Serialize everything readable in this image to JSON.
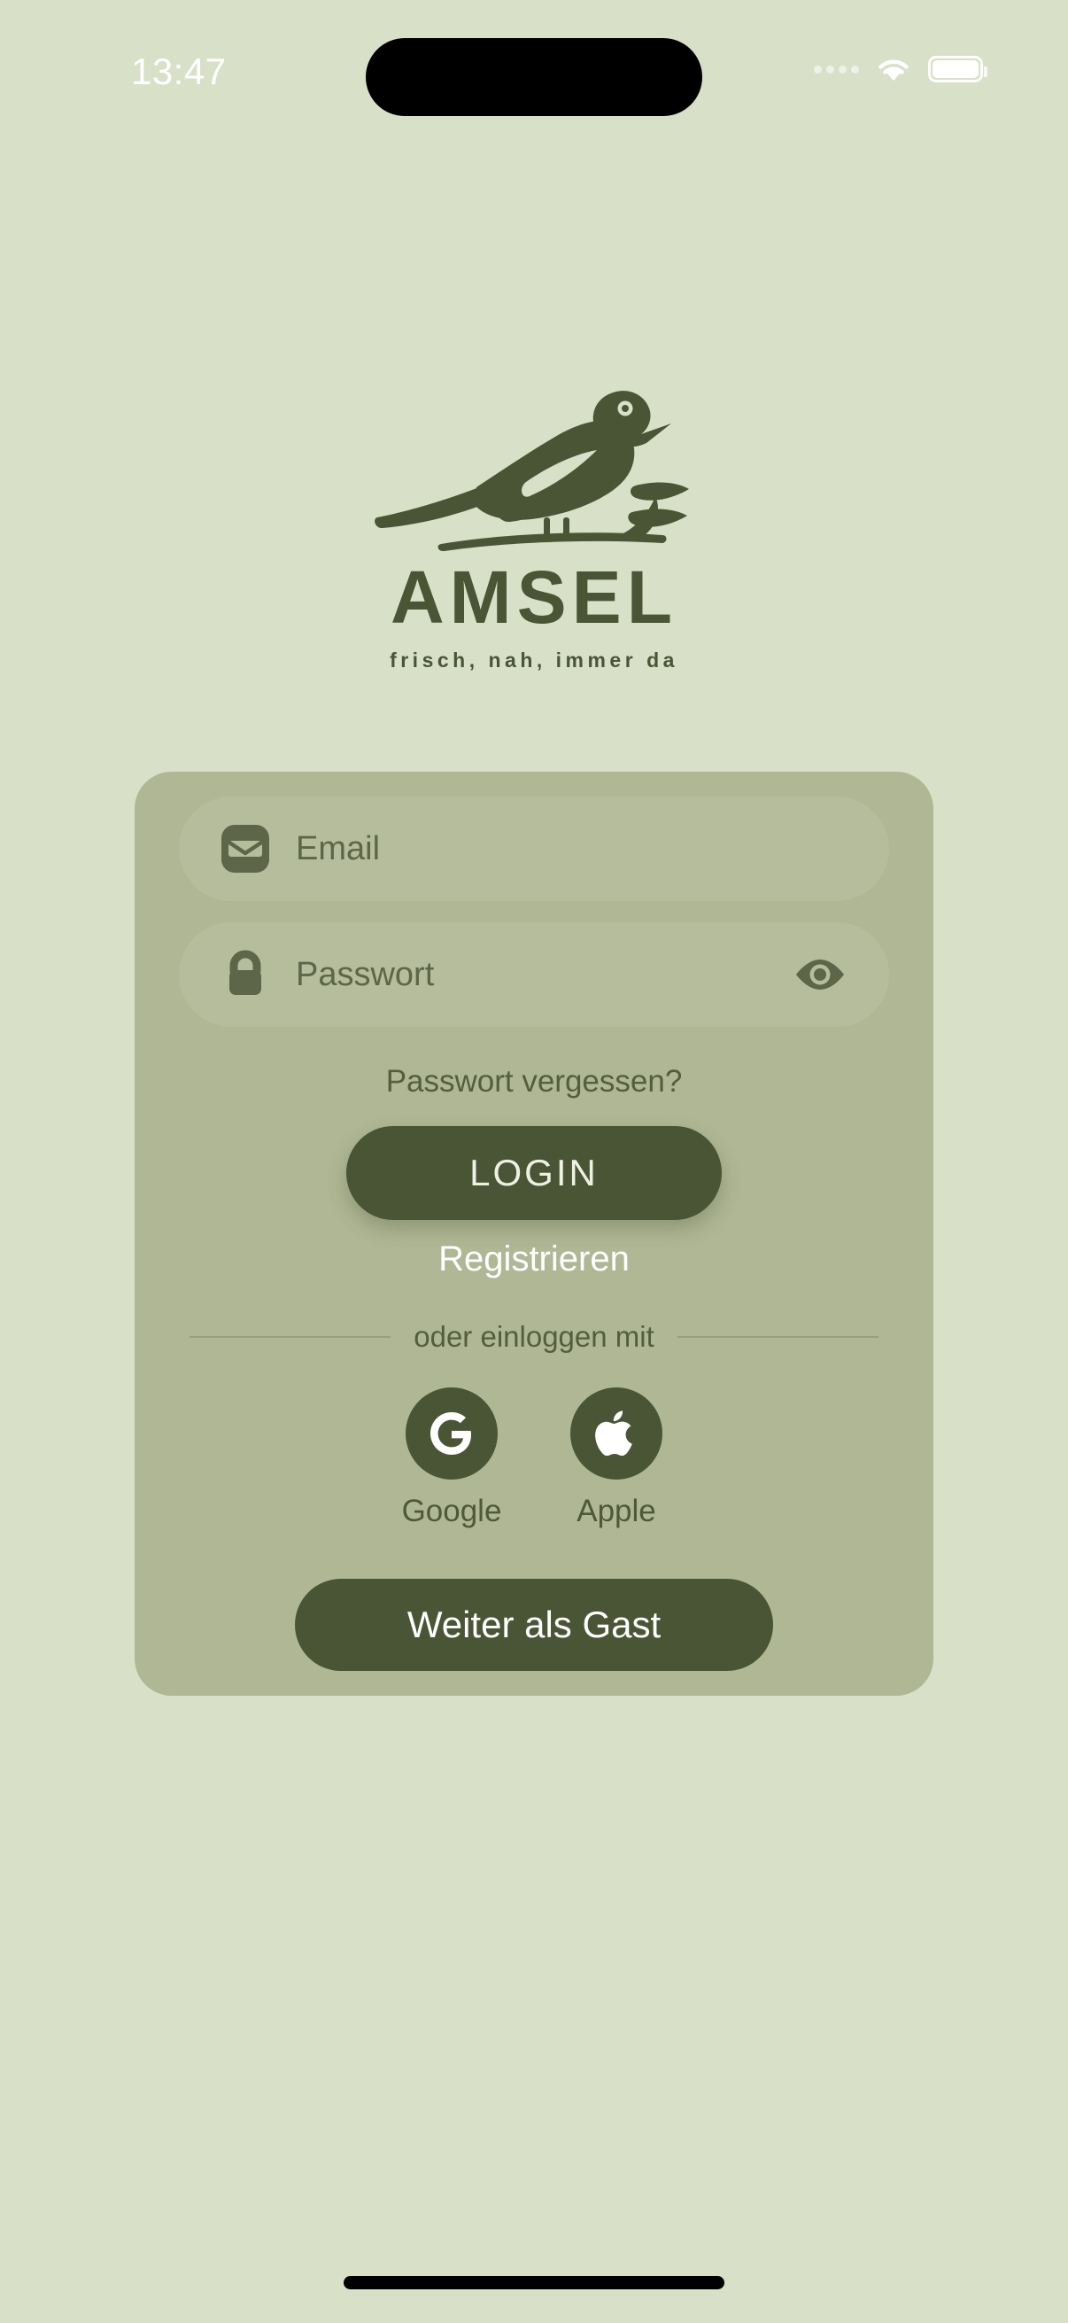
{
  "status_bar": {
    "time": "13:47",
    "signal_icon": "signal-dots-icon",
    "wifi_icon": "wifi-icon",
    "battery_icon": "battery-full-icon"
  },
  "brand": {
    "logo_icon": "blackbird-on-branch-logo",
    "name": "AMSEL",
    "tagline": "frisch, nah, immer da"
  },
  "form": {
    "email": {
      "placeholder": "Email",
      "value": "",
      "icon": "envelope-icon"
    },
    "password": {
      "placeholder": "Passwort",
      "value": "",
      "icon": "lock-icon",
      "toggle_icon": "eye-icon"
    },
    "forgot_password_label": "Passwort vergessen?",
    "login_label": "LOGIN",
    "register_label": "Registrieren"
  },
  "social": {
    "divider_label": "oder einloggen mit",
    "providers": [
      {
        "label": "Google",
        "icon": "google-g-icon"
      },
      {
        "label": "Apple",
        "icon": "apple-logo-icon"
      }
    ]
  },
  "guest": {
    "label": "Weiter als Gast"
  },
  "colors": {
    "background": "#d9e0c8",
    "card": "#afb795",
    "field": "#b5bd9c",
    "accent_dark": "#4a5535",
    "text_muted": "#545e3e",
    "text_on_dark": "#ffffff"
  }
}
